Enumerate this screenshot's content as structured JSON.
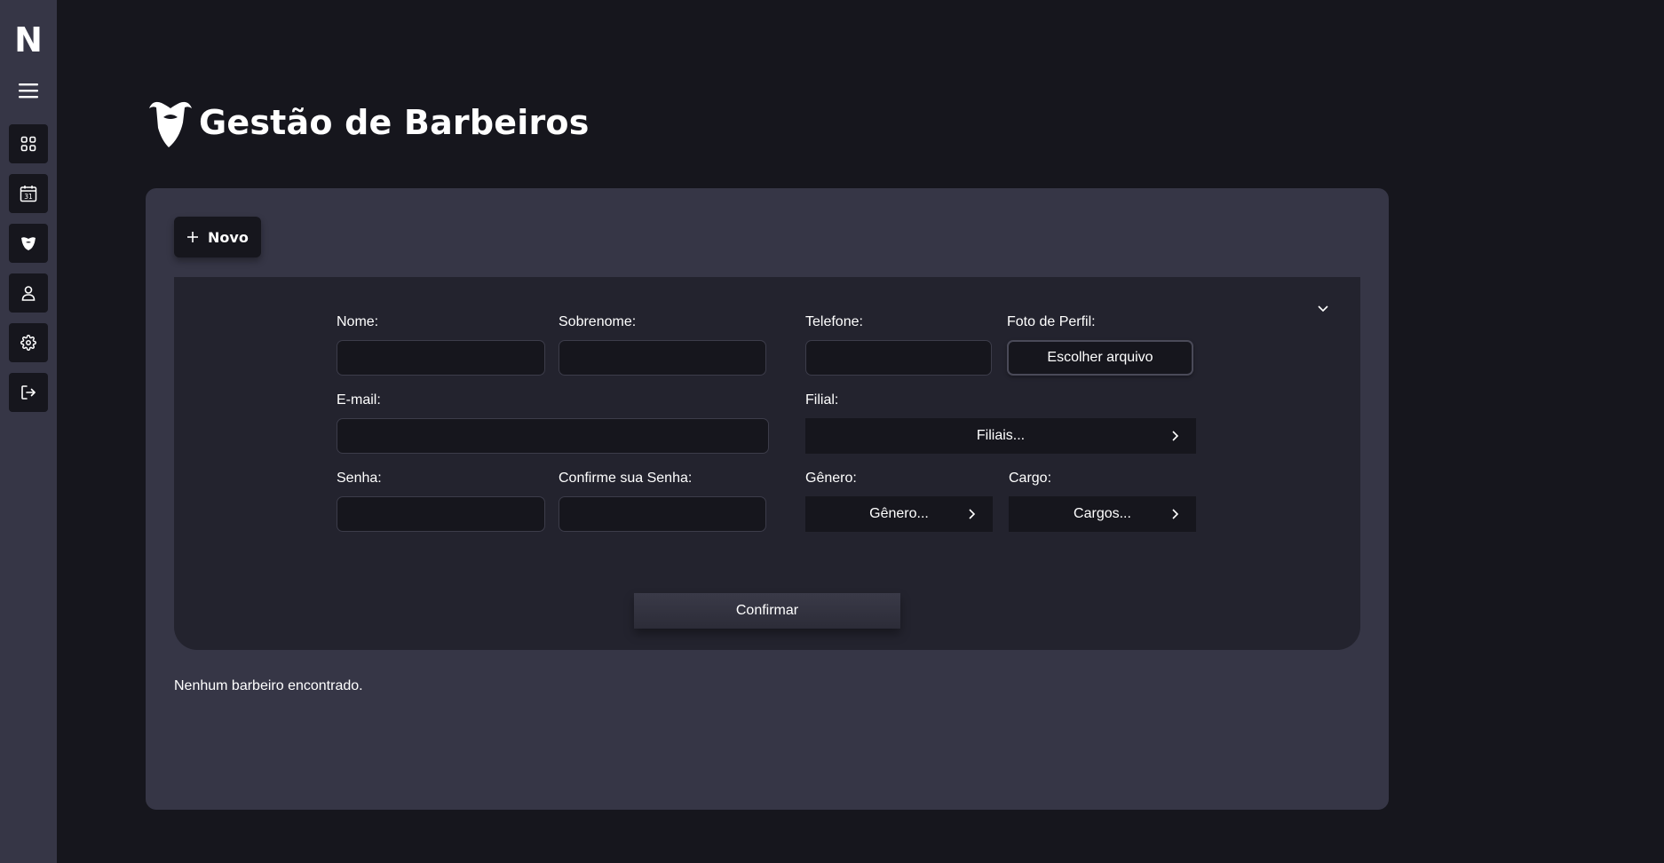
{
  "app": {
    "logo_letter": "N"
  },
  "sidebar": {
    "items": [
      {
        "icon": "dashboard-grid-icon"
      },
      {
        "icon": "calendar-icon",
        "calendar_day": "31"
      },
      {
        "icon": "beard-icon"
      },
      {
        "icon": "user-icon"
      },
      {
        "icon": "gear-icon"
      },
      {
        "icon": "logout-icon"
      }
    ]
  },
  "page": {
    "title": "Gestão de Barbeiros"
  },
  "toolbar": {
    "new_label": "Novo"
  },
  "form": {
    "nome_label": "Nome:",
    "sobrenome_label": "Sobrenome:",
    "telefone_label": "Telefone:",
    "foto_label": "Foto de Perfil:",
    "foto_button": "Escolher arquivo",
    "email_label": "E-mail:",
    "filial_label": "Filial:",
    "filial_select": "Filiais...",
    "senha_label": "Senha:",
    "confirme_label": "Confirme sua Senha:",
    "genero_label": "Gênero:",
    "genero_select": "Gênero...",
    "cargo_label": "Cargo:",
    "cargo_select": "Cargos...",
    "nome_value": "",
    "sobrenome_value": "",
    "telefone_value": "",
    "email_value": "",
    "senha_value": "",
    "confirme_value": "",
    "confirm_button": "Confirmar"
  },
  "list": {
    "empty_message": "Nenhum barbeiro encontrado."
  },
  "colors": {
    "background": "#16161d",
    "sidebar": "#363646",
    "card": "#363646",
    "panel": "#23232e",
    "input": "#16161d"
  }
}
